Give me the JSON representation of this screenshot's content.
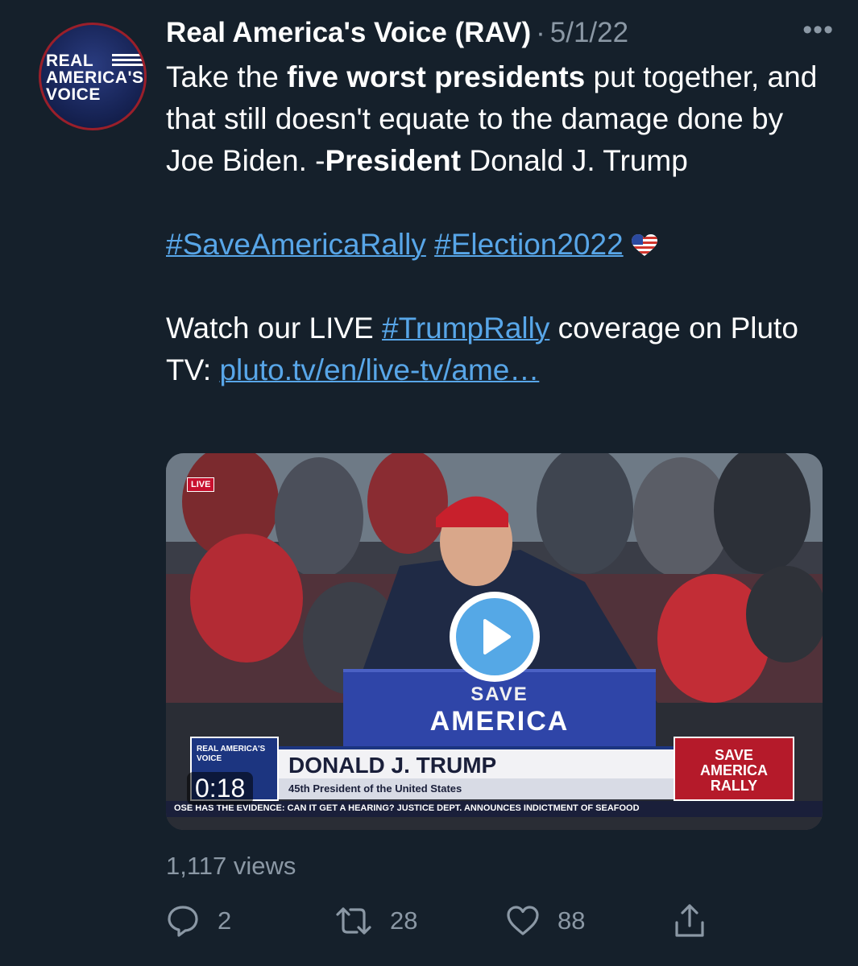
{
  "tweet": {
    "author_name": "Real America's Voice (RAV)",
    "separator": "·",
    "date": "5/1/22",
    "more_label": "•••",
    "avatar": {
      "line1": "REAL",
      "line2": "AMERICA'S",
      "line3": "VOICE"
    },
    "text": {
      "p1_a": "Take the ",
      "p1_bold1": "five worst presidents",
      "p1_b": " put together, and that still doesn't equate to the damage done by Joe Biden. -",
      "p1_bold2": "President",
      "p1_c": " Donald J. Trump",
      "hashtag1": "#SaveAmericaRally",
      "hashtag2": "#Election2022",
      "p3_a": "Watch our LIVE ",
      "hashtag3": "#TrumpRally",
      "p3_b": " coverage on Pluto TV: ",
      "url": "pluto.tv/en/live-tv/ame…"
    },
    "media": {
      "live_badge": "LIVE",
      "podium_top": "SAVE",
      "podium_main": "AMERICA",
      "lower_third_name": "DONALD J. TRUMP",
      "lower_third_sub": "45th President of the United States",
      "lower_third_logo": "REAL AMERICA'S VOICE",
      "rally_line1": "SAVE",
      "rally_line2": "AMERICA",
      "rally_line3": "RALLY",
      "ticker": "OSE HAS THE EVIDENCE: CAN IT GET A HEARING?        JUSTICE DEPT. ANNOUNCES INDICTMENT OF SEAFOOD",
      "timer": "0:18"
    },
    "views": "1,117 views",
    "actions": {
      "reply_count": "2",
      "retweet_count": "28",
      "like_count": "88"
    },
    "colors": {
      "background": "#15202b",
      "link": "#58a6e8",
      "muted": "#8b98a5",
      "play_button": "#55a8e6"
    },
    "icons": [
      "reply-icon",
      "retweet-icon",
      "like-icon",
      "share-icon",
      "play-icon",
      "more-icon",
      "flag-heart-icon"
    ]
  }
}
